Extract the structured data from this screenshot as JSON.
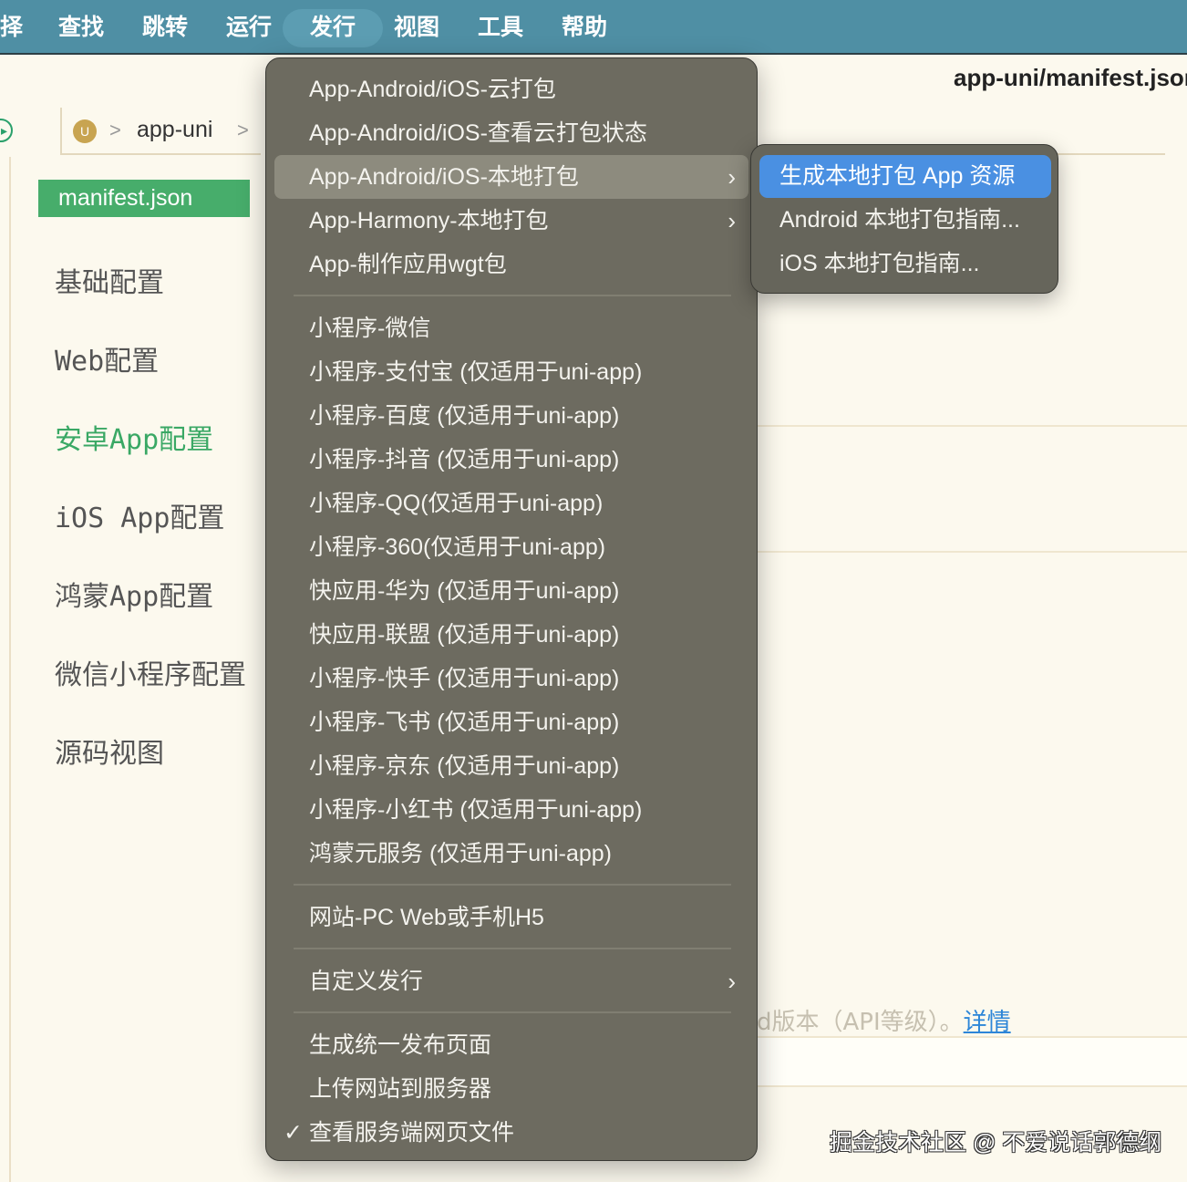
{
  "menubar": {
    "items": [
      "择",
      "查找",
      "跳转",
      "运行",
      "发行",
      "视图",
      "工具",
      "帮助"
    ],
    "active": "发行"
  },
  "breadcrumb": {
    "project_icon": "U",
    "project": "app-uni"
  },
  "editor": {
    "title": "app-uni/manifest.json"
  },
  "sidebar": {
    "file": "manifest.json",
    "items": [
      "基础配置",
      "Web配置",
      "安卓App配置",
      "iOS App配置",
      "鸿蒙App配置",
      "微信小程序配置",
      "源码视图"
    ],
    "selected": "安卓App配置"
  },
  "content": {
    "desc": "d版本（API等级）。",
    "link": "详情"
  },
  "watermark": "掘金技术社区 @ 不爱说话郭德纲",
  "menu": {
    "groups": [
      [
        {
          "label": "App-Android/iOS-云打包"
        },
        {
          "label": "App-Android/iOS-查看云打包状态"
        },
        {
          "label": "App-Android/iOS-本地打包",
          "submenu": true,
          "highlighted": true
        },
        {
          "label": "App-Harmony-本地打包",
          "submenu": true
        },
        {
          "label": "App-制作应用wgt包"
        }
      ],
      [
        {
          "label": "小程序-微信"
        },
        {
          "label": "小程序-支付宝 (仅适用于uni-app)"
        },
        {
          "label": "小程序-百度 (仅适用于uni-app)"
        },
        {
          "label": "小程序-抖音 (仅适用于uni-app)"
        },
        {
          "label": "小程序-QQ(仅适用于uni-app)"
        },
        {
          "label": "小程序-360(仅适用于uni-app)"
        },
        {
          "label": "快应用-华为 (仅适用于uni-app)"
        },
        {
          "label": "快应用-联盟 (仅适用于uni-app)"
        },
        {
          "label": "小程序-快手 (仅适用于uni-app)"
        },
        {
          "label": "小程序-飞书 (仅适用于uni-app)"
        },
        {
          "label": "小程序-京东 (仅适用于uni-app)"
        },
        {
          "label": "小程序-小红书 (仅适用于uni-app)"
        },
        {
          "label": "鸿蒙元服务 (仅适用于uni-app)"
        }
      ],
      [
        {
          "label": "网站-PC Web或手机H5"
        }
      ],
      [
        {
          "label": "自定义发行",
          "submenu": true
        }
      ],
      [
        {
          "label": "生成统一发布页面"
        },
        {
          "label": "上传网站到服务器"
        },
        {
          "label": "查看服务端网页文件",
          "checked": true
        }
      ]
    ]
  },
  "submenu": {
    "items": [
      "生成本地打包 App 资源",
      "Android 本地打包指南...",
      "iOS 本地打包指南..."
    ],
    "highlighted": 0
  },
  "glyphs": {
    "arrow": "›",
    "check": "✓",
    "chevron": ">"
  },
  "colors": {
    "menubar": "#4f8fa4",
    "menu": "#6d6b60",
    "highlight": "#4a90e2",
    "accent": "#47ad6b"
  }
}
